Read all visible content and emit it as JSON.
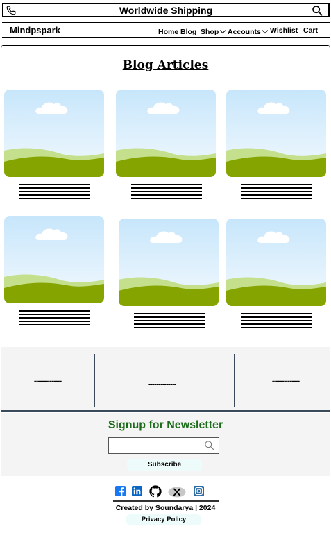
{
  "topbar": {
    "title": "Worldwide Shipping",
    "left_icon": "phone-icon",
    "right_icon": "search-icon"
  },
  "nav": {
    "brand": "Mindpspark",
    "links": [
      "Home",
      "Blog",
      "Shop",
      "Accounts",
      "Wishlist",
      "Cart"
    ]
  },
  "blog": {
    "title": "Blog Articles",
    "card_image": "landscape-placeholder",
    "article_count": 6
  },
  "stats": {
    "items": [
      "--------------",
      "--------------",
      "--------------"
    ]
  },
  "newsletter": {
    "title": "Signup for Newsletter",
    "input_placeholder": "",
    "subscribe_label": "Subscribe",
    "title_color": "#1b6b1b"
  },
  "footer": {
    "social_icons": [
      "facebook-icon",
      "linkedin-icon",
      "github-icon",
      "x-icon",
      "instagram-icon"
    ],
    "credit": "Created by Soundarya | 2024",
    "privacy_label": "Privacy Policy"
  }
}
